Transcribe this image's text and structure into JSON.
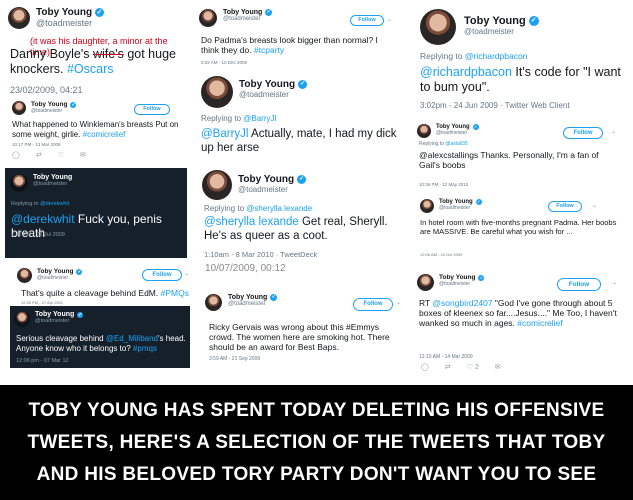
{
  "user": {
    "name": "Toby Young",
    "handle": "@toadmeister"
  },
  "follow_label": "Follow",
  "replying_prefix": "Replying to",
  "tweets": {
    "t1": {
      "note": "(it was his daughter, a minor at the time)",
      "pre": "Danny Boyle's ",
      "struck": "wife's",
      "post": " got huge knockers. ",
      "tag": "#Oscars",
      "date": "23/02/2009, 04:21"
    },
    "t2": {
      "text": "What happened to Winkleman's breasts Put on some weight, girlie. ",
      "tag": "#comicrelief",
      "date": "10:17 PM - 13 Mar 2009"
    },
    "t3": {
      "reply": "@derekwhit",
      "mention": "@derekwhit",
      "text": " Fuck you, penis breath",
      "date": "7:47 PM - 22 Jul 2009"
    },
    "t4": {
      "text": "That's quite a cleavage behind EdM. ",
      "tag": "#PMQs",
      "date": "12:35 PM - 27 Apr 2011"
    },
    "t5": {
      "pre": "Serious cleavage behind ",
      "mention": "@Ed_Miliband",
      "mid": "'s head. Anyone know who it belongs to? ",
      "tag": "#pmqs",
      "date": "12:06 pm - 07 Mar 12"
    },
    "t6": {
      "text": "Do Padma's breasts look bigger than normal? I think they do. ",
      "tag": "#tcparty",
      "date": "3:02 AM - 10 Dec 2009"
    },
    "t7": {
      "reply": "@BarryJl",
      "mention": "@BarryJl",
      "text": " Actually, mate, I had my dick up her arse"
    },
    "t8": {
      "reply": "@sherylla lexande",
      "mention": "@sherylla lexande",
      "text": " Get real, Sheryll. He's as queer as a coot.",
      "date": "1:10am - 8 Mar 2010 · TweetDeck",
      "overlap": "10/07/2009, 00:12"
    },
    "t9": {
      "text": "Ricky Gervais was wrong about this #Emmys crowd. The women here are smoking hot. There should be an award for Best Baps.",
      "date": "3:59 AM - 21 Sep 2009"
    },
    "t10": {
      "reply": "@richardpbacon",
      "mention": "@richardpbacon",
      "text": " It's code for \"I want to bum you\".",
      "date": "3:02pm - 24 Jun 2009 · Twitter Web Client"
    },
    "t11": {
      "reply": "@astall35",
      "text": "@alexcstallings Thanks. Personally, I'm a fan of Gail's boobs",
      "date": "10:36 PM - 12 May 2010"
    },
    "t12": {
      "text": "In hotel room with five-months pregnant Padma. Her boobs are MASSIVE. Be careful what you wish for ...",
      "date": "12:06 AM - 24 Oct 2009"
    },
    "t13": {
      "pre": "RT ",
      "mention": "@songbird2407",
      "text": " \"God I've gone through about 5 boxes of kleenex so far....Jesus....\" Me Too, I haven't wanked so much in ages. ",
      "tag": "#comicrelief",
      "date": "12:10 AM - 14 Mar 2009",
      "likes": "2"
    }
  },
  "caption": {
    "line1": "TOBY YOUNG HAS SPENT TODAY DELETING HIS OFFENSIVE",
    "line2": "TWEETS, HERE'S A SELECTION OF THE TWEETS THAT TOBY",
    "line3": "AND HIS BELOVED TORY PARTY DON'T WANT YOU TO SEE"
  }
}
